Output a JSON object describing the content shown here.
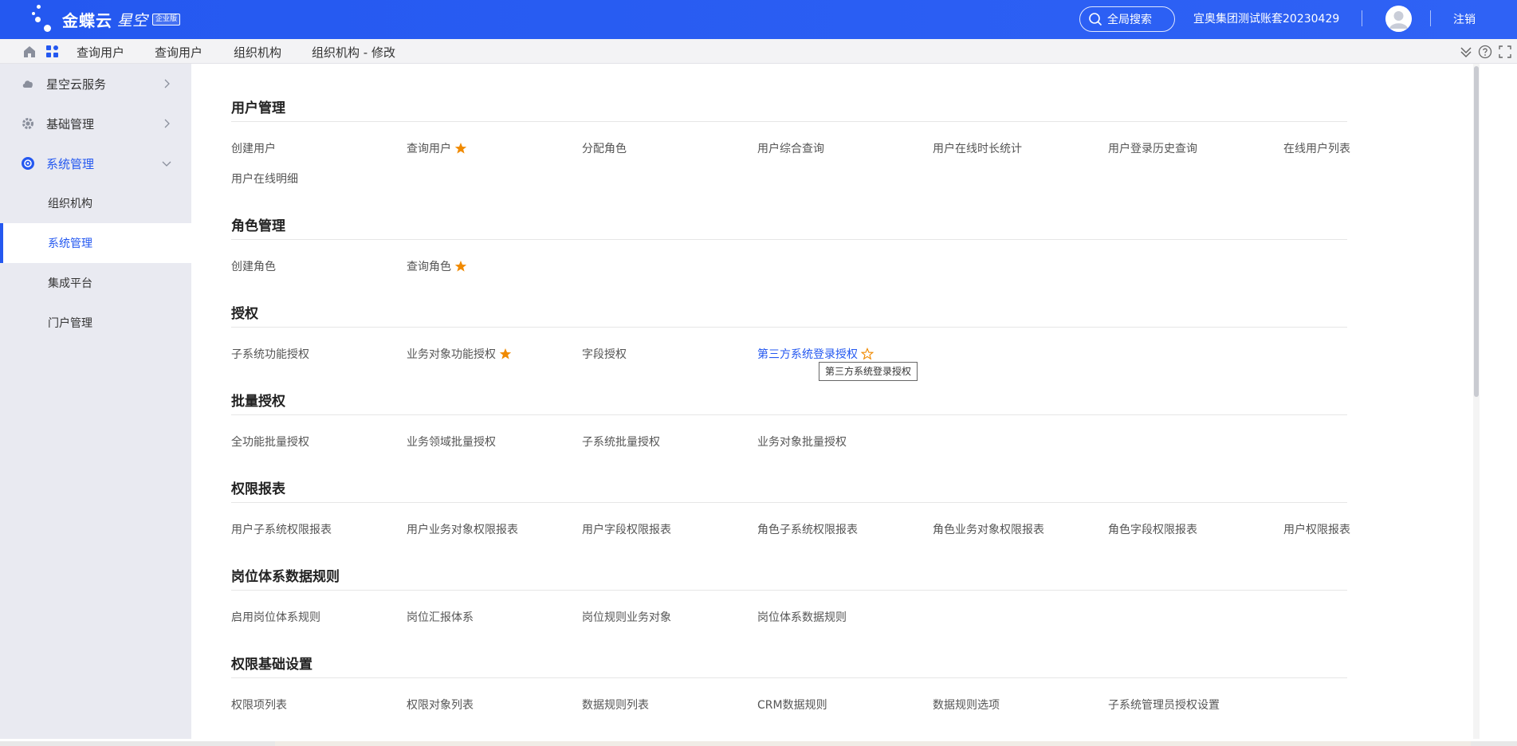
{
  "app": {
    "logo_text": "金蝶云",
    "logo_sub": "星空",
    "logo_badge": "企业版",
    "search_label": "全局搜索",
    "account_name": "宜奥集团测试账套20230429",
    "logout_label": "注销",
    "brand_color": "#2458f0"
  },
  "tabs": [
    {
      "label": "查询用户"
    },
    {
      "label": "查询用户"
    },
    {
      "label": "组织机构"
    },
    {
      "label": "组织机构 - 修改"
    }
  ],
  "sidebar": {
    "items": [
      {
        "label": "星空云服务",
        "icon": "cloud-icon",
        "expanded": false
      },
      {
        "label": "基础管理",
        "icon": "gear-icon",
        "expanded": false
      },
      {
        "label": "系统管理",
        "icon": "system-icon",
        "expanded": true
      }
    ],
    "subitems": [
      {
        "label": "组织机构"
      },
      {
        "label": "系统管理",
        "active": true
      },
      {
        "label": "集成平台"
      },
      {
        "label": "门户管理"
      }
    ]
  },
  "sections": [
    {
      "title": "用户管理",
      "links": [
        {
          "label": "创建用户"
        },
        {
          "label": "查询用户",
          "starred": true
        },
        {
          "label": "分配角色"
        },
        {
          "label": "用户综合查询"
        },
        {
          "label": "用户在线时长统计"
        },
        {
          "label": "用户登录历史查询"
        },
        {
          "label": "在线用户列表"
        },
        {
          "label": "用户在线明细"
        }
      ]
    },
    {
      "title": "角色管理",
      "links": [
        {
          "label": "创建角色"
        },
        {
          "label": "查询角色",
          "starred": true
        }
      ]
    },
    {
      "title": "授权",
      "links": [
        {
          "label": "子系统功能授权"
        },
        {
          "label": "业务对象功能授权",
          "starred": true
        },
        {
          "label": "字段授权"
        },
        {
          "label": "第三方系统登录授权",
          "hovered": true,
          "star_outline": true
        }
      ]
    },
    {
      "title": "批量授权",
      "links": [
        {
          "label": "全功能批量授权"
        },
        {
          "label": "业务领域批量授权"
        },
        {
          "label": "子系统批量授权"
        },
        {
          "label": "业务对象批量授权"
        }
      ]
    },
    {
      "title": "权限报表",
      "links": [
        {
          "label": "用户子系统权限报表"
        },
        {
          "label": "用户业务对象权限报表"
        },
        {
          "label": "用户字段权限报表"
        },
        {
          "label": "角色子系统权限报表"
        },
        {
          "label": "角色业务对象权限报表"
        },
        {
          "label": "角色字段权限报表"
        },
        {
          "label": "用户权限报表"
        }
      ]
    },
    {
      "title": "岗位体系数据规则",
      "links": [
        {
          "label": "启用岗位体系规则"
        },
        {
          "label": "岗位汇报体系"
        },
        {
          "label": "岗位规则业务对象"
        },
        {
          "label": "岗位体系数据规则"
        }
      ]
    },
    {
      "title": "权限基础设置",
      "links": [
        {
          "label": "权限项列表"
        },
        {
          "label": "权限对象列表"
        },
        {
          "label": "数据规则列表"
        },
        {
          "label": "CRM数据规则"
        },
        {
          "label": "数据规则选项"
        },
        {
          "label": "子系统管理员授权设置"
        }
      ]
    }
  ],
  "tooltip": {
    "text": "第三方系统登录授权"
  },
  "colors": {
    "star": "#f08a00",
    "link_hover": "#2458f0"
  }
}
